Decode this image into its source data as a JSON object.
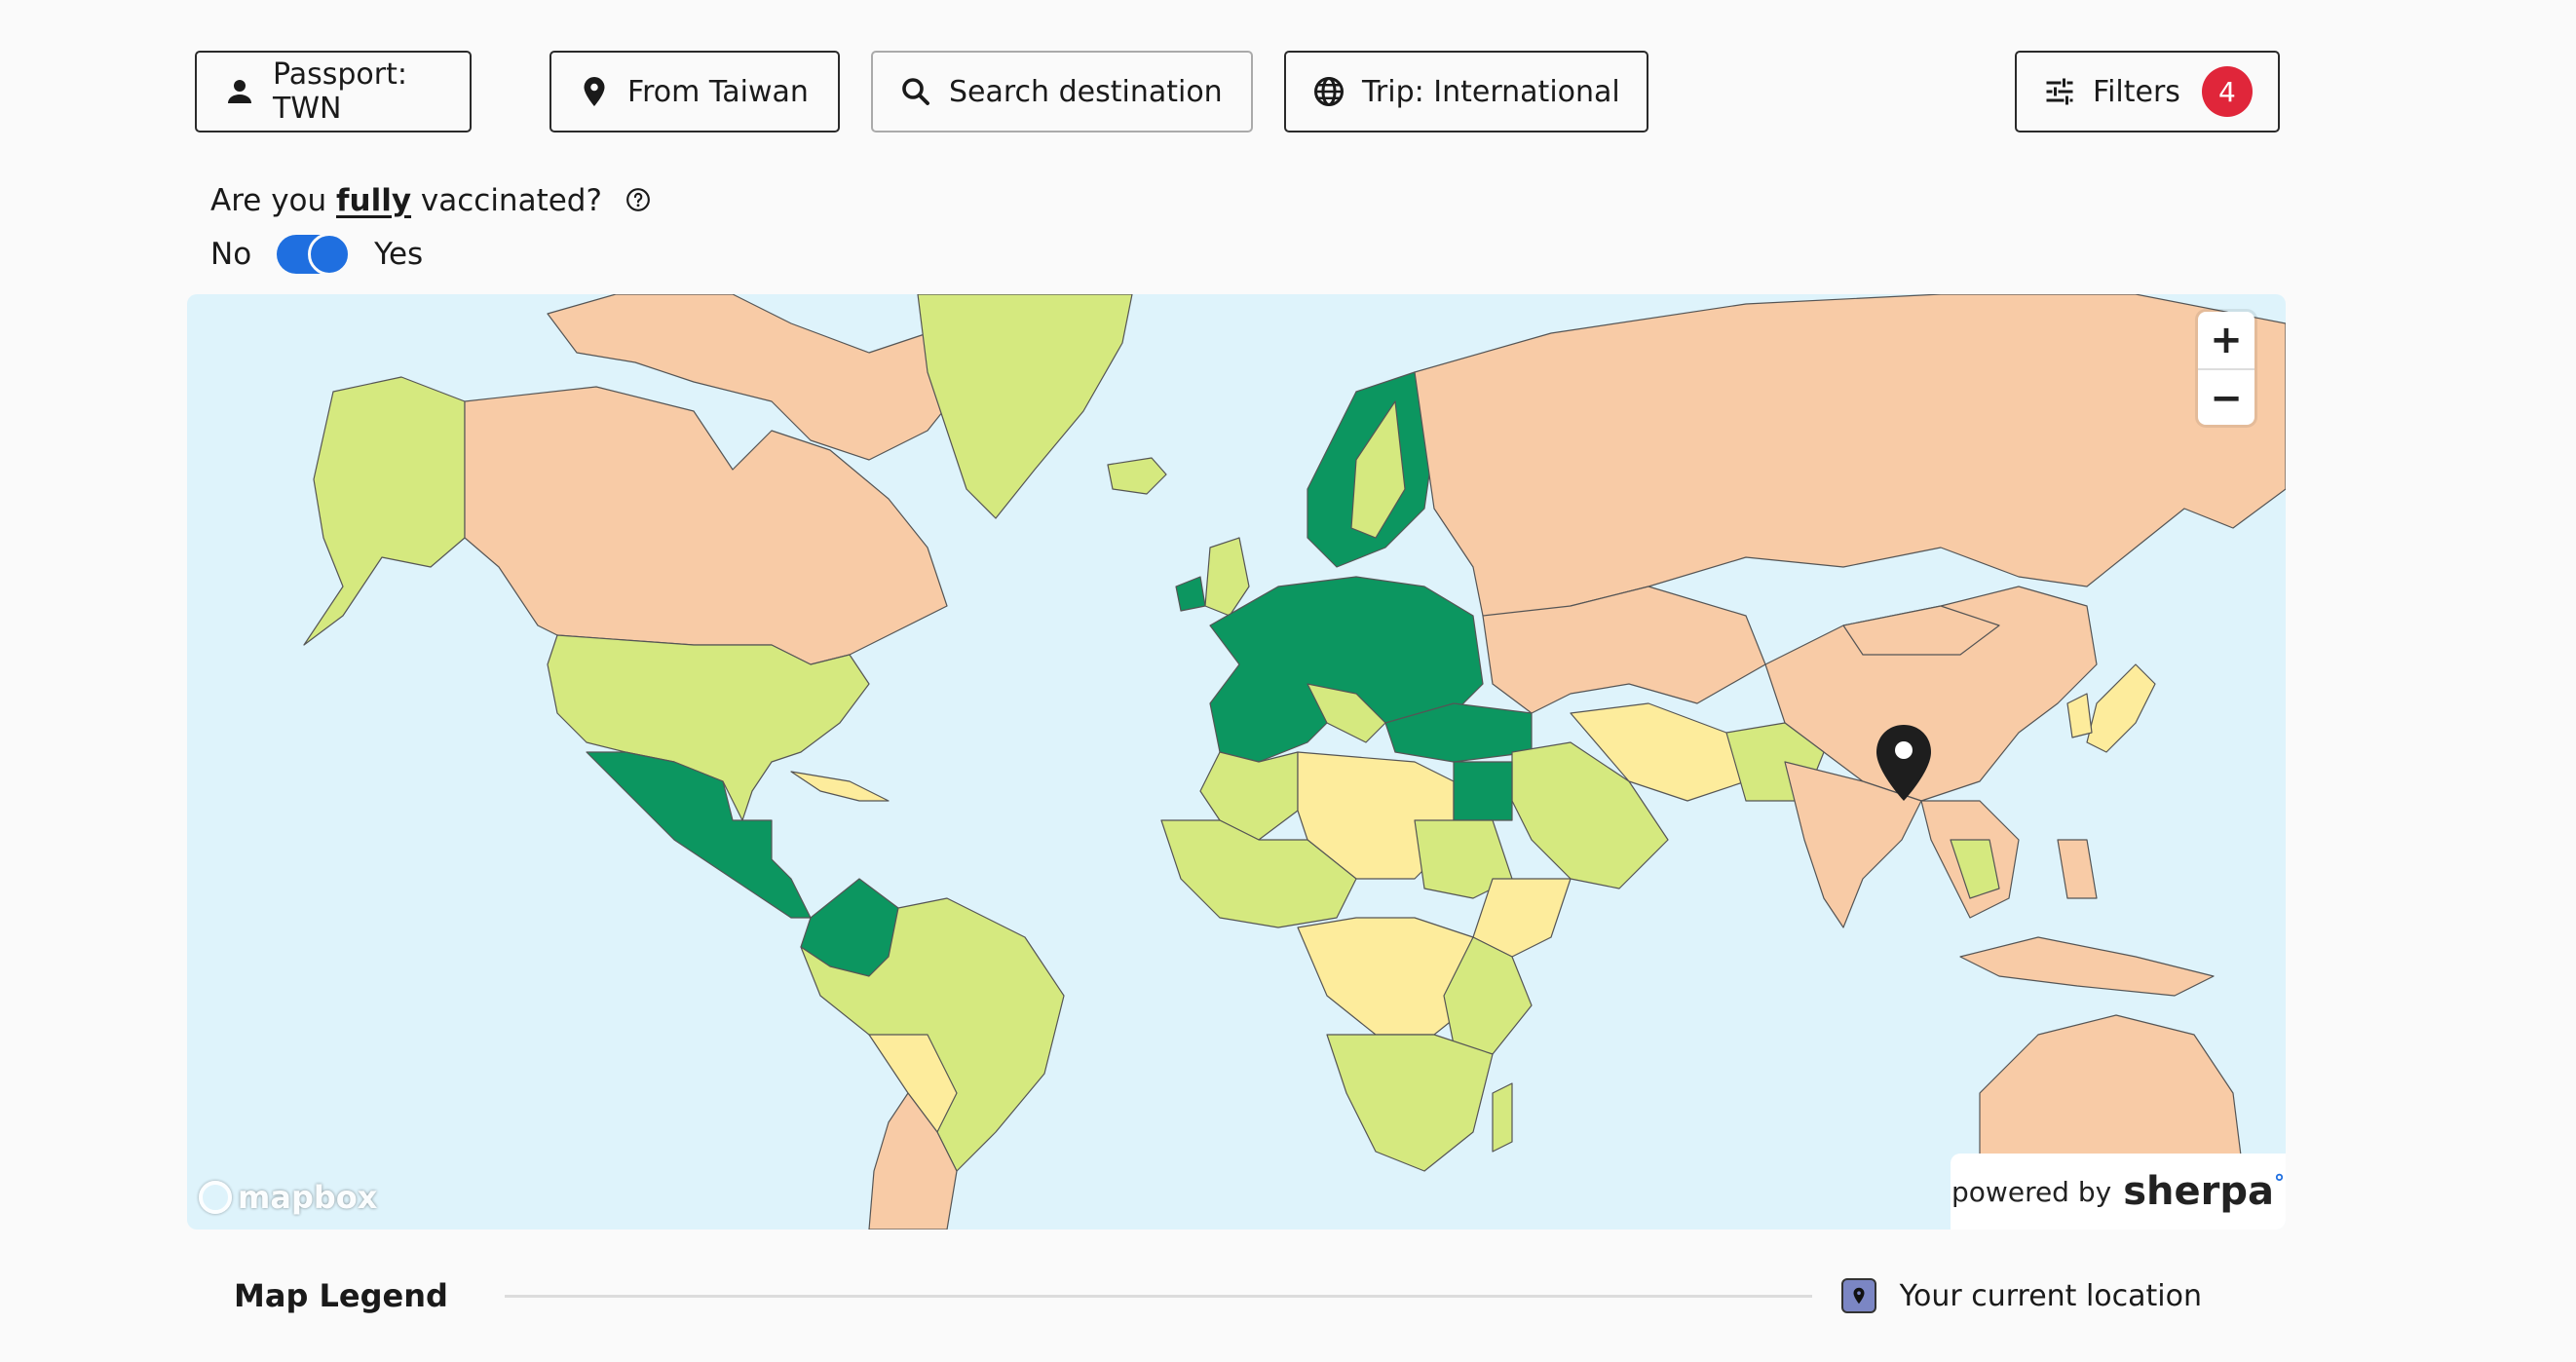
{
  "toolbar": {
    "passport": "Passport: TWN",
    "origin": "From Taiwan",
    "search": "Search destination",
    "trip": "Trip: International",
    "filters": "Filters",
    "filters_count": "4"
  },
  "vaccination": {
    "question_prefix": "Are you ",
    "question_emphasis": "fully",
    "question_suffix": " vaccinated?",
    "no_label": "No",
    "yes_label": "Yes",
    "vaccinated": true
  },
  "map": {
    "zoom_in": "+",
    "zoom_out": "−",
    "attribution": "mapbox",
    "powered_by": "powered by",
    "brand": "sherpa",
    "brand_mark": "°",
    "colors": {
      "water": "#def3fb",
      "open": "#0c9660",
      "partial": "#d5e97f",
      "moderate": "#fdec9c",
      "restricted": "#f8cba6",
      "no_data": "#eeeeee"
    }
  },
  "legend": {
    "title": "Map Legend",
    "current_location": "Your current location"
  }
}
